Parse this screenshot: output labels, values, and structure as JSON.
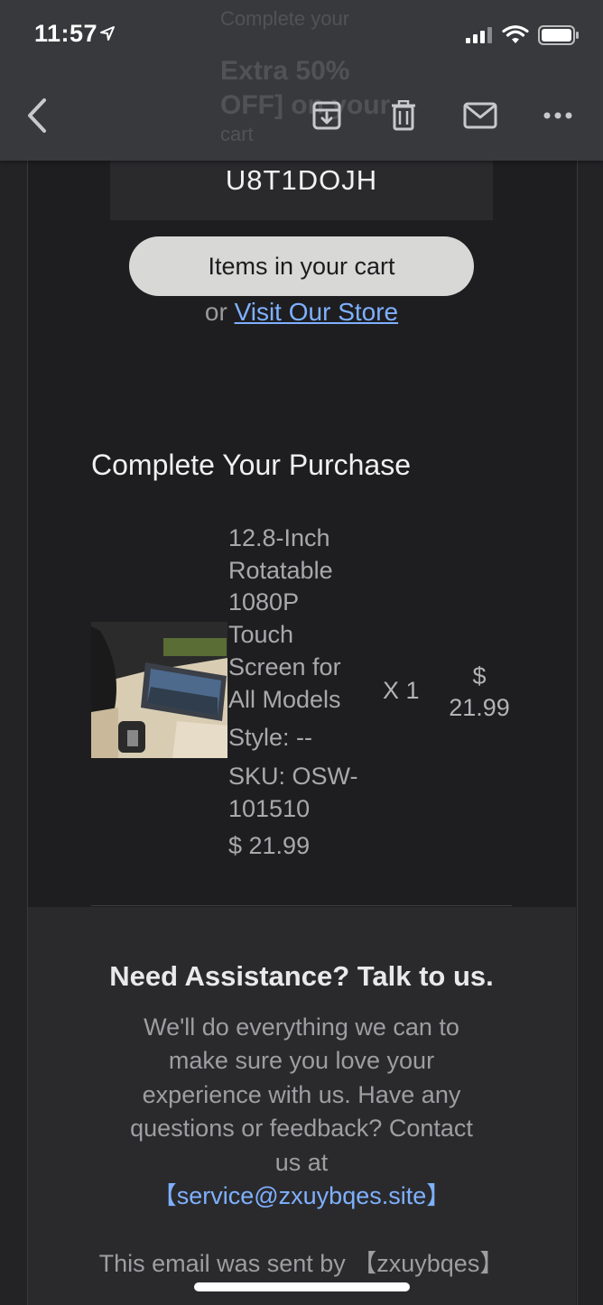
{
  "status_bar": {
    "time": "11:57"
  },
  "ghost_subject": {
    "line1": "Complete your",
    "line2": "Extra 50%",
    "line3": "OFF] on your",
    "line4": "cart"
  },
  "email": {
    "coupon_code": "U8T1DOJH",
    "cart_button_label": "Items in your cart",
    "or_text": "or",
    "store_link": "Visit Our Store",
    "section_title": "Complete Your Purchase",
    "product": {
      "name_lines": [
        "12.8-Inch",
        "Rotatable",
        "1080P",
        "Touch",
        "Screen for",
        "All Models"
      ],
      "style": "Style: --",
      "sku_lines": [
        "SKU: OSW-",
        "101510"
      ],
      "unit_price": "$ 21.99",
      "quantity": "X 1",
      "price_symbol": "$",
      "price_value": "21.99"
    },
    "assistance": {
      "title": "Need Assistance? Talk to us.",
      "body_lines": [
        "We'll do everything we can to",
        "make sure you love your",
        "experience with us. Have any",
        "questions or feedback? Contact",
        "us at"
      ],
      "email": "【service@zxuybqes.site】",
      "sent_by": "This email was sent by 【zxuybqes】"
    }
  },
  "colors": {
    "link": "#7fb0ff",
    "toolbar": "#38393c",
    "background": "#1e1e21"
  }
}
